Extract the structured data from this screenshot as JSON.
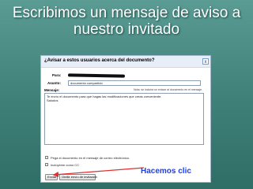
{
  "slide": {
    "title_line1": "Escribimos un mensaje de aviso a",
    "title_line2": "nuestro invitado",
    "annotation": "Hacemos clic",
    "annotation_color": "#1a3cff",
    "arrow_color": "#e03030"
  },
  "dialog": {
    "title": "¿Avisar a estos usuarios acerca del documento?",
    "close_glyph": "x",
    "to_label": "Para:",
    "subject_label": "Asunto:",
    "subject_value": "documento compartido",
    "message_label": "Mensaje:",
    "note": "Nota: se incluirá un enlace al documento en el mensaje.",
    "message_lines": [
      "Te envío el documento para que hagas las modificaciones que creas conveniente.",
      "Saludos"
    ],
    "options": [
      {
        "label": "Pega el documento en el mensaje de correo electrónico.",
        "checked": false
      },
      {
        "label": "Inclúyeme como CC",
        "checked": false
      }
    ],
    "buttons": {
      "send": "Enviar",
      "skip": "Omitir envío de invitación"
    }
  }
}
